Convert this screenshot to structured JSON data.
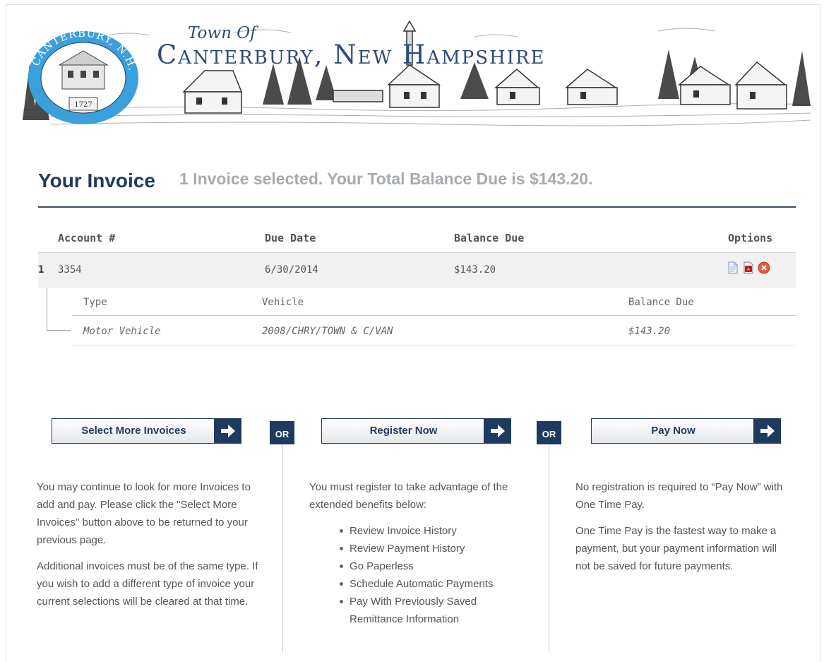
{
  "banner": {
    "town_of": "Town Of",
    "town_name": "Canterbury, New Hampshire",
    "seal_text": "CANTERBURY, N.H.",
    "seal_year": "1727"
  },
  "header": {
    "title": "Your Invoice",
    "summary": "1 Invoice selected. Your Total Balance Due is $143.20."
  },
  "invoice_table": {
    "columns": [
      "Account #",
      "Due Date",
      "Balance Due",
      "Options"
    ],
    "rows": [
      {
        "index": "1",
        "account": "3354",
        "due_date": "6/30/2014",
        "balance_due": "$143.20",
        "options": [
          "document-icon",
          "pdf-icon",
          "remove-icon"
        ],
        "detail": {
          "columns": [
            "Type",
            "Vehicle",
            "Balance Due"
          ],
          "type": "Motor Vehicle",
          "vehicle": "2008/CHRY/TOWN & C/VAN",
          "balance_due": "$143.20"
        }
      }
    ]
  },
  "actions": {
    "or_label": "OR",
    "select_more": {
      "label": "Select More Invoices",
      "p1": "You may continue to look for more Invoices to add and pay. Please click the \"Select More Invoices\" button above to be returned to your previous page.",
      "p2": "Additional invoices must be of the same type. If you wish to add a different type of invoice your current selections will be cleared at that time."
    },
    "register": {
      "label": "Register Now",
      "intro": "You must register to take advantage of the extended benefits below:",
      "benefits": [
        "Review Invoice History",
        "Review Payment History",
        "Go Paperless",
        "Schedule Automatic Payments",
        "Pay With Previously Saved Remittance Information"
      ]
    },
    "pay_now": {
      "label": "Pay Now",
      "p1": "No registration is required to “Pay Now” with One Time Pay.",
      "p2": "One Time Pay is the fastest way to make a payment, but your payment information will not be saved for future payments."
    }
  },
  "colors": {
    "navy": "#1e3a5f",
    "seal_blue": "#39a0db",
    "muted_text": "#a6abb0"
  }
}
